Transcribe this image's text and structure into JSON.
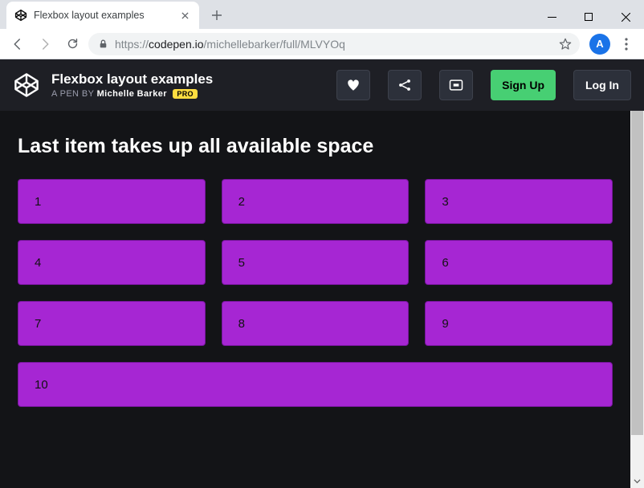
{
  "browser": {
    "tab_title": "Flexbox layout examples",
    "url_scheme": "https://",
    "url_host": "codepen.io",
    "url_path": "/michellebarker/full/MLVYOq",
    "avatar_letter": "A"
  },
  "codepen_header": {
    "title": "Flexbox layout examples",
    "sub_prefix": "A PEN BY",
    "author": "Michelle Barker",
    "pro_badge": "PRO",
    "signup_label": "Sign Up",
    "login_label": "Log In"
  },
  "page": {
    "heading": "Last item takes up all available space",
    "items": [
      "1",
      "2",
      "3",
      "4",
      "5",
      "6",
      "7",
      "8",
      "9",
      "10"
    ]
  },
  "colors": {
    "box_bg": "#a626d3",
    "accent_green": "#47cf73",
    "page_bg": "#131417"
  }
}
